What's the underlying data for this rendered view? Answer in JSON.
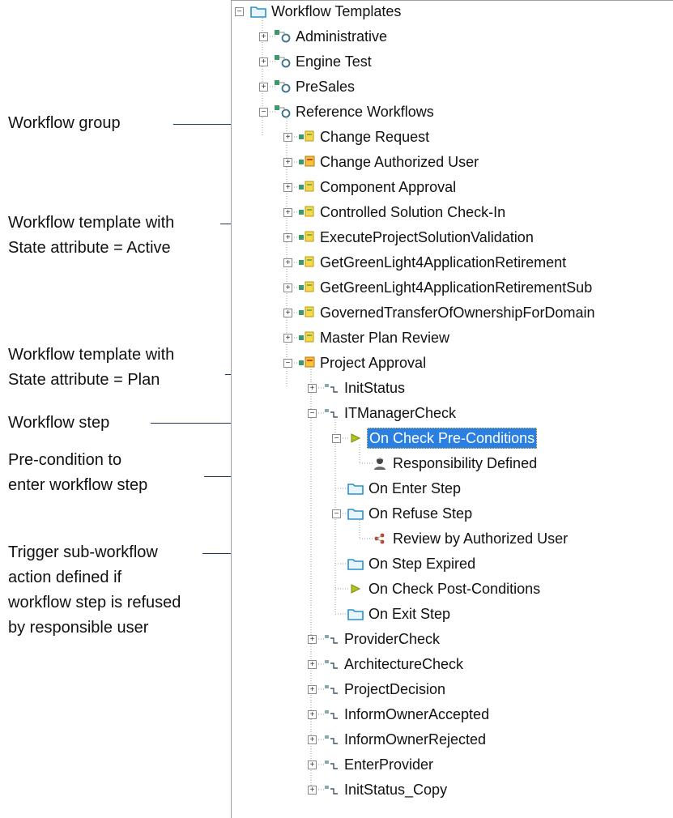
{
  "annotations": [
    {
      "id": "group",
      "text": "Workflow group"
    },
    {
      "id": "template-active",
      "text": "Workflow template  with\nState attribute = Active"
    },
    {
      "id": "template-plan",
      "text": "Workflow template  with\nState attribute = Plan"
    },
    {
      "id": "step",
      "text": "Workflow step"
    },
    {
      "id": "precondition",
      "text": "Pre-condition to\nenter workflow  step"
    },
    {
      "id": "trigger",
      "text": "Trigger sub-workflow\naction defined if\nworkflow step is refused\nby responsible user"
    }
  ],
  "tree": [
    {
      "label": "Workflow Templates",
      "level": 0,
      "icon": "folder-icon",
      "expanded": true
    },
    {
      "label": "Administrative",
      "level": 1,
      "icon": "workflow-group-icon",
      "expanded": false
    },
    {
      "label": "Engine Test",
      "level": 1,
      "icon": "workflow-group-icon",
      "expanded": false
    },
    {
      "label": "PreSales",
      "level": 1,
      "icon": "workflow-group-icon",
      "expanded": false
    },
    {
      "label": "Reference Workflows",
      "level": 1,
      "icon": "workflow-group-icon",
      "expanded": true
    },
    {
      "label": "Change Request",
      "level": 2,
      "icon": "template-active-icon",
      "expanded": false
    },
    {
      "label": "Change Authorized User",
      "level": 2,
      "icon": "template-plan-icon",
      "expanded": false
    },
    {
      "label": "Component Approval",
      "level": 2,
      "icon": "template-active-icon",
      "expanded": false
    },
    {
      "label": "Controlled Solution Check-In",
      "level": 2,
      "icon": "template-active-icon",
      "expanded": false
    },
    {
      "label": "ExecuteProjectSolutionValidation",
      "level": 2,
      "icon": "template-active-icon",
      "expanded": false
    },
    {
      "label": "GetGreenLight4ApplicationRetirement",
      "level": 2,
      "icon": "template-active-icon",
      "expanded": false
    },
    {
      "label": "GetGreenLight4ApplicationRetirementSub",
      "level": 2,
      "icon": "template-active-icon",
      "expanded": false
    },
    {
      "label": "GovernedTransferOfOwnershipForDomain",
      "level": 2,
      "icon": "template-active-icon",
      "expanded": false
    },
    {
      "label": "Master Plan Review",
      "level": 2,
      "icon": "template-active-icon",
      "expanded": false
    },
    {
      "label": "Project Approval",
      "level": 2,
      "icon": "template-plan-icon",
      "expanded": true
    },
    {
      "label": "InitStatus",
      "level": 3,
      "icon": "step-icon",
      "expanded": false
    },
    {
      "label": "ITManagerCheck",
      "level": 3,
      "icon": "step-icon",
      "expanded": true
    },
    {
      "label": "On Check Pre-Conditions",
      "level": 4,
      "icon": "condition-icon",
      "expanded": true,
      "selected": true
    },
    {
      "label": "Responsibility Defined",
      "level": 5,
      "icon": "responsibility-icon",
      "expanded": null
    },
    {
      "label": "On Enter Step",
      "level": 4,
      "icon": "folder-icon",
      "expanded": null
    },
    {
      "label": "On Refuse Step",
      "level": 4,
      "icon": "folder-icon",
      "expanded": true
    },
    {
      "label": "Review by Authorized User",
      "level": 5,
      "icon": "subworkflow-icon",
      "expanded": null
    },
    {
      "label": "On Step Expired",
      "level": 4,
      "icon": "folder-icon",
      "expanded": null
    },
    {
      "label": "On Check Post-Conditions",
      "level": 4,
      "icon": "condition-icon",
      "expanded": null
    },
    {
      "label": "On Exit Step",
      "level": 4,
      "icon": "folder-icon",
      "expanded": null
    },
    {
      "label": "ProviderCheck",
      "level": 3,
      "icon": "step-icon",
      "expanded": false
    },
    {
      "label": "ArchitectureCheck",
      "level": 3,
      "icon": "step-icon",
      "expanded": false
    },
    {
      "label": "ProjectDecision",
      "level": 3,
      "icon": "step-icon",
      "expanded": false
    },
    {
      "label": "InformOwnerAccepted",
      "level": 3,
      "icon": "step-icon",
      "expanded": false
    },
    {
      "label": "InformOwnerRejected",
      "level": 3,
      "icon": "step-icon",
      "expanded": false
    },
    {
      "label": "EnterProvider",
      "level": 3,
      "icon": "step-icon",
      "expanded": false
    },
    {
      "label": "InitStatus_Copy",
      "level": 3,
      "icon": "step-icon",
      "expanded": false
    }
  ],
  "colors": {
    "selection": "#2b7fe0",
    "arrow": "#1d3a5a",
    "folder": "#2c8fc7",
    "group_green": "#3a9a6a"
  }
}
